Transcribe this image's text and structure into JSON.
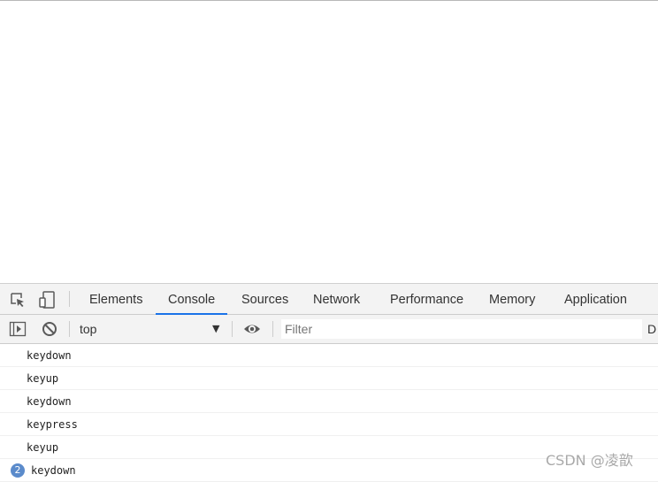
{
  "tabs": [
    {
      "label": "Elements",
      "active": false
    },
    {
      "label": "Console",
      "active": true
    },
    {
      "label": "Sources",
      "active": false
    },
    {
      "label": "Network",
      "active": false
    },
    {
      "label": "Performance",
      "active": false
    },
    {
      "label": "Memory",
      "active": false
    },
    {
      "label": "Application",
      "active": false
    }
  ],
  "toolbar": {
    "context": "top",
    "filter_placeholder": "Filter",
    "overflow_text": "D"
  },
  "log": [
    {
      "text": "keydown"
    },
    {
      "text": "keyup"
    },
    {
      "text": "keydown"
    },
    {
      "text": "keypress"
    },
    {
      "text": "keyup"
    },
    {
      "text": "keydown",
      "count": "2"
    }
  ],
  "watermark": "CSDN @凌歆",
  "colors": {
    "accent": "#1a73e8",
    "badge": "#5b8bcb"
  },
  "icons": [
    "inspect-element-icon",
    "device-toolbar-icon",
    "sidebar-toggle-icon",
    "clear-console-icon",
    "dropdown-arrow-icon",
    "eye-icon"
  ]
}
